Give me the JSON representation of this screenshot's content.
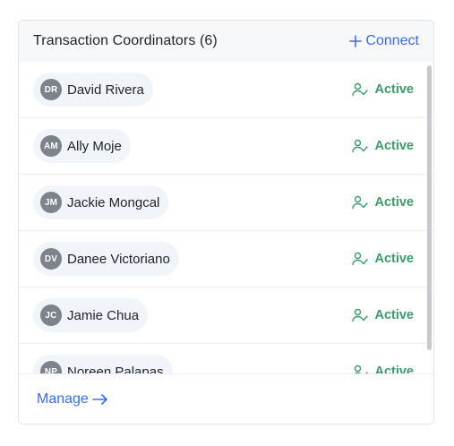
{
  "panel": {
    "title": "Transaction Coordinators (6)",
    "connect_label": "Connect",
    "manage_label": "Manage",
    "accent_color": "#3b6cf0",
    "active_color": "#3d9a6b"
  },
  "coordinators": [
    {
      "initials": "DR",
      "name": "David Rivera",
      "status": "Active"
    },
    {
      "initials": "AM",
      "name": "Ally Moje",
      "status": "Active"
    },
    {
      "initials": "JM",
      "name": "Jackie Mongcal",
      "status": "Active"
    },
    {
      "initials": "DV",
      "name": "Danee Victoriano",
      "status": "Active"
    },
    {
      "initials": "JC",
      "name": "Jamie Chua",
      "status": "Active"
    },
    {
      "initials": "NP",
      "name": "Noreen Palapas",
      "status": "Active"
    }
  ],
  "icons": {
    "connect": "plus-icon",
    "status": "user-check-icon",
    "manage": "arrow-right-icon"
  }
}
